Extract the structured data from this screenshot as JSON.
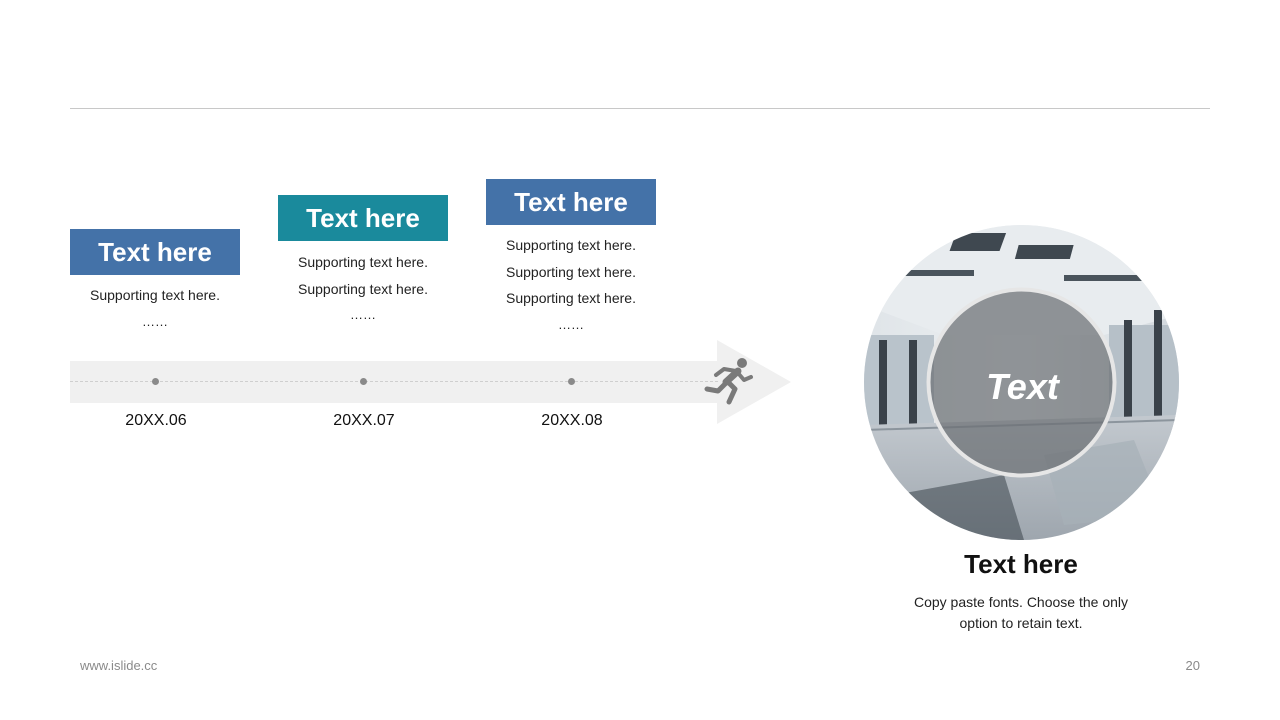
{
  "colors": {
    "card_blue": "#4472a8",
    "card_teal": "#1a8a9c",
    "arrow_band": "#f0f0f0",
    "dot": "#8a8a8a",
    "runner": "#7a7a7a"
  },
  "milestones": [
    {
      "title": "Text here",
      "support_lines": [
        "Supporting text here."
      ],
      "ellipsis": "……",
      "date": "20XX.06",
      "color": "#4472a8"
    },
    {
      "title": "Text here",
      "support_lines": [
        "Supporting text here.",
        "Supporting text here."
      ],
      "ellipsis": "……",
      "date": "20XX.07",
      "color": "#1a8a9c"
    },
    {
      "title": "Text here",
      "support_lines": [
        "Supporting text here.",
        "Supporting text here.",
        "Supporting text here."
      ],
      "ellipsis": "……",
      "date": "20XX.08",
      "color": "#4472a8"
    }
  ],
  "runner_icon": "running-person-icon",
  "photo": {
    "caption": "Text",
    "subject": "modern interior with glass walls"
  },
  "right_panel": {
    "title": "Text here",
    "body": "Copy paste fonts. Choose the only option to retain text."
  },
  "footer": {
    "url": "www.islide.cc",
    "page_number": "20"
  }
}
